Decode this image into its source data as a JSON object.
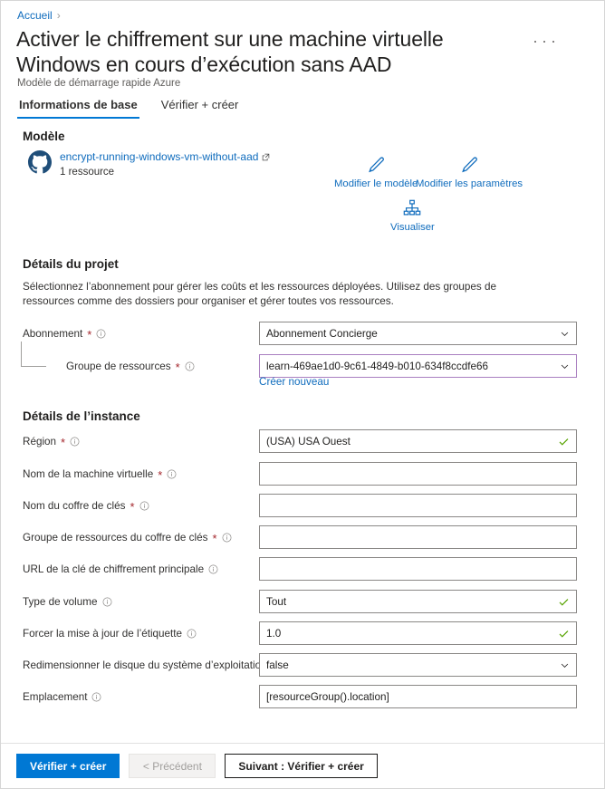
{
  "breadcrumb": {
    "home": "Accueil",
    "separator": "›"
  },
  "header": {
    "title": "Activer le chiffrement sur une machine virtuelle Windows en cours d’exécution sans AAD",
    "subtitle": "Modèle de démarrage rapide Azure",
    "more_actions": "…"
  },
  "tabs": [
    {
      "label": "Informations de base",
      "active": true
    },
    {
      "label": "Vérifier + créer",
      "active": false
    }
  ],
  "template": {
    "heading": "Modèle",
    "name": "encrypt-running-windows-vm-without-aad",
    "resource_count": "1 ressource",
    "actions": [
      {
        "label": "Modifier le modèle",
        "icon": "pencil-icon"
      },
      {
        "label": "Modifier les paramètres",
        "icon": "pencil-icon"
      },
      {
        "label": "Visualiser",
        "icon": "sitemap-icon"
      }
    ]
  },
  "project_details": {
    "heading": "Détails du projet",
    "description": "Sélectionnez l’abonnement pour gérer les coûts et les ressources déployées. Utilisez des groupes de ressources comme des dossiers pour organiser et gérer toutes vos ressources.",
    "fields": [
      {
        "label": "Abonnement",
        "required": true,
        "info": true,
        "control": "dropdown",
        "value": "Abonnement Concierge",
        "placeholder": "",
        "focused": false,
        "valid": false,
        "indent": false
      },
      {
        "label": "Groupe de ressources",
        "required": true,
        "info": true,
        "control": "dropdown",
        "value": "learn-469ae1d0-9c61-4849-b010-634f8ccdfe66",
        "placeholder": "",
        "focused": true,
        "valid": false,
        "indent": true
      }
    ],
    "create_new_link": "Créer nouveau"
  },
  "instance_details": {
    "heading": "Détails de l’instance",
    "fields": [
      {
        "label": "Région",
        "required": true,
        "info": true,
        "control": "text",
        "value": "(USA) USA Ouest",
        "placeholder": "",
        "valid": true
      },
      {
        "label": "Nom de la machine virtuelle",
        "required": true,
        "info": true,
        "control": "text",
        "value": "",
        "placeholder": "",
        "valid": false
      },
      {
        "label": "Nom du coffre de clés",
        "required": true,
        "info": true,
        "control": "text",
        "value": "",
        "placeholder": "",
        "valid": false
      },
      {
        "label": "Groupe de ressources du coffre de clés",
        "required": true,
        "info": true,
        "control": "text",
        "value": "",
        "placeholder": "",
        "valid": false
      },
      {
        "label": "URL de la clé de chiffrement principale",
        "required": false,
        "info": true,
        "control": "text",
        "value": "",
        "placeholder": "",
        "valid": false
      },
      {
        "label": "Type de volume",
        "required": false,
        "info": true,
        "control": "text",
        "value": "Tout",
        "placeholder": "",
        "valid": true
      },
      {
        "label": "Forcer la mise à jour de l’étiquette",
        "required": false,
        "info": true,
        "control": "text",
        "value": "1.0",
        "placeholder": "",
        "valid": true
      },
      {
        "label": "Redimensionner le disque du système d’exploitation",
        "required": false,
        "info": true,
        "control": "dropdown",
        "value": "false",
        "placeholder": "",
        "valid": false
      },
      {
        "label": "Emplacement",
        "required": false,
        "info": true,
        "control": "text",
        "value": "[resourceGroup().location]",
        "placeholder": "",
        "valid": false
      }
    ]
  },
  "footer": {
    "buttons": [
      {
        "label": "Vérifier + créer",
        "style": "primary",
        "disabled": false
      },
      {
        "label": "< Précédent",
        "style": "disabled",
        "disabled": true
      },
      {
        "label": "Suivant : Vérifier + créer",
        "style": "secondary",
        "disabled": false
      }
    ]
  },
  "colors": {
    "accent": "#0078d4",
    "link": "#0f6cbd",
    "required_asterisk": "#a4262c",
    "focus_border": "#a97fc0",
    "valid_check": "#57a300"
  }
}
